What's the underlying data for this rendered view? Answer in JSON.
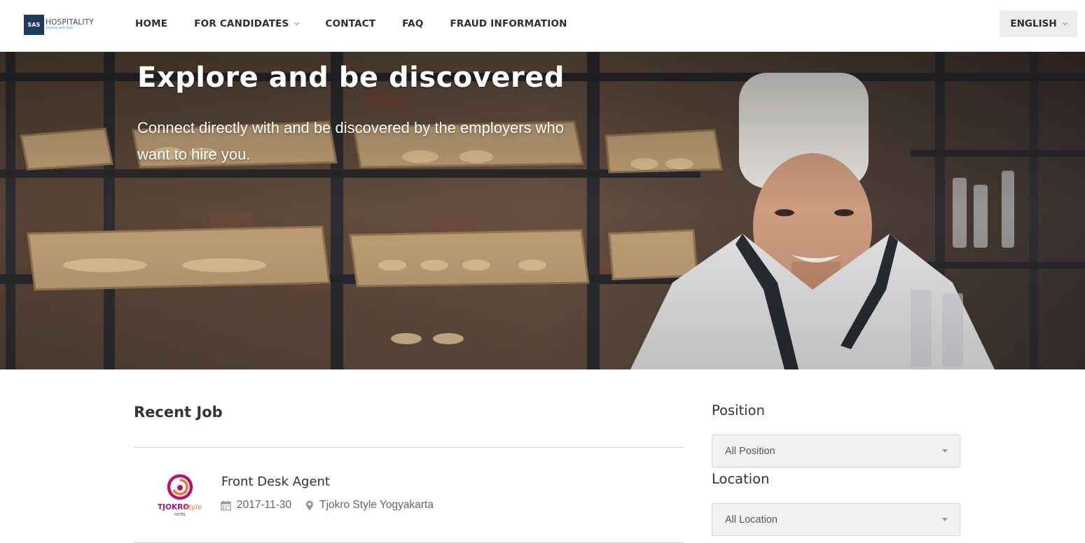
{
  "header": {
    "logo": {
      "mark": "SAS",
      "name": "HOSPITALITY",
      "tagline": "Serving with Soul"
    },
    "nav": [
      {
        "label": "HOME",
        "has_dropdown": false
      },
      {
        "label": "FOR CANDIDATES",
        "has_dropdown": true
      },
      {
        "label": "CONTACT",
        "has_dropdown": false
      },
      {
        "label": "FAQ",
        "has_dropdown": false
      },
      {
        "label": "FRAUD INFORMATION",
        "has_dropdown": false
      }
    ],
    "language": {
      "selected": "ENGLISH",
      "icon": "chevron-down-icon"
    }
  },
  "hero": {
    "title": "Explore and be discovered",
    "subtitle": "Connect directly with and be discovered by the employers who want to hire you."
  },
  "recent_jobs": {
    "title": "Recent Job",
    "jobs": [
      {
        "title": "Front Desk Agent",
        "date": "2017-11-30",
        "location": "Tjokro Style Yogyakarta",
        "logo": {
          "brand": "TJOKRO",
          "brand_style": "Style",
          "sub": "HOTEL"
        },
        "date_icon": "calendar-icon",
        "location_icon": "map-marker-icon"
      }
    ]
  },
  "filters": {
    "position": {
      "label": "Position",
      "selected": "All Position"
    },
    "location": {
      "label": "Location",
      "selected": "All Location"
    }
  },
  "colors": {
    "logo_navy": "#1d3b5c",
    "logo_tagline": "#3a8ac4",
    "tjokro_magenta": "#b5166b",
    "tjokro_orange": "#e8772a"
  }
}
